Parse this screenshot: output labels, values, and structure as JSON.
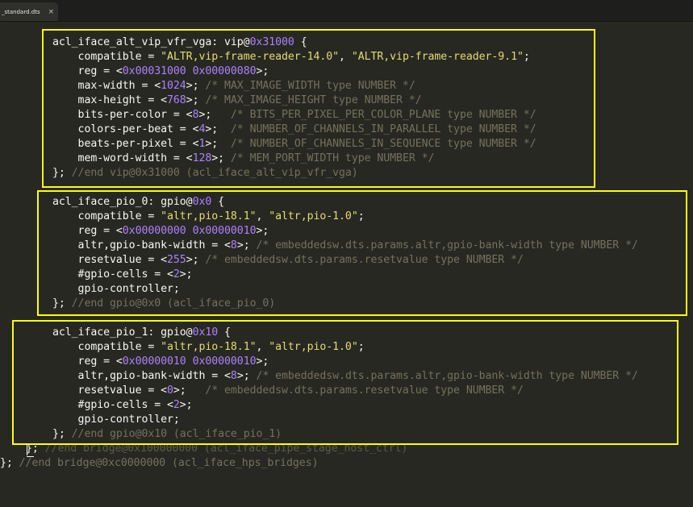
{
  "tab": {
    "title": "_standard.dts",
    "close_glyph": "×"
  },
  "code": [
    [
      [
        "t",
        "acl_iface_alt_vip_vfr_vga: vip@"
      ],
      [
        "n",
        "0x31000"
      ],
      [
        "t",
        " {"
      ]
    ],
    [
      [
        "t",
        "    compatible = "
      ],
      [
        "s",
        "\"ALTR,vip-frame-reader-14.0\""
      ],
      [
        "t",
        ", "
      ],
      [
        "s",
        "\"ALTR,vip-frame-reader-9.1\""
      ],
      [
        "t",
        ";"
      ]
    ],
    [
      [
        "t",
        "    reg = <"
      ],
      [
        "n",
        "0x00031000 0x00000080"
      ],
      [
        "t",
        ">;"
      ]
    ],
    [
      [
        "t",
        "    max-width = <"
      ],
      [
        "n",
        "1024"
      ],
      [
        "t",
        ">; "
      ],
      [
        "c",
        "/* MAX_IMAGE_WIDTH type NUMBER */"
      ]
    ],
    [
      [
        "t",
        "    max-height = <"
      ],
      [
        "n",
        "768"
      ],
      [
        "t",
        ">; "
      ],
      [
        "c",
        "/* MAX_IMAGE_HEIGHT type NUMBER */"
      ]
    ],
    [
      [
        "t",
        "    bits-per-color = <"
      ],
      [
        "n",
        "8"
      ],
      [
        "t",
        ">;   "
      ],
      [
        "c",
        "/* BITS_PER_PIXEL_PER_COLOR_PLANE type NUMBER */"
      ]
    ],
    [
      [
        "t",
        "    colors-per-beat = <"
      ],
      [
        "n",
        "4"
      ],
      [
        "t",
        ">;  "
      ],
      [
        "c",
        "/* NUMBER_OF_CHANNELS_IN_PARALLEL type NUMBER */"
      ]
    ],
    [
      [
        "t",
        "    beats-per-pixel = <"
      ],
      [
        "n",
        "1"
      ],
      [
        "t",
        ">;  "
      ],
      [
        "c",
        "/* NUMBER_OF_CHANNELS_IN_SEQUENCE type NUMBER */"
      ]
    ],
    [
      [
        "t",
        "    mem-word-width = <"
      ],
      [
        "n",
        "128"
      ],
      [
        "t",
        ">; "
      ],
      [
        "c",
        "/* MEM_PORT_WIDTH type NUMBER */"
      ]
    ],
    [
      [
        "t",
        "}; "
      ],
      [
        "c",
        "//end vip@0x31000 (acl_iface_alt_vip_vfr_vga)"
      ]
    ],
    [],
    [
      [
        "t",
        "acl_iface_pio_0: gpio@"
      ],
      [
        "n",
        "0x0"
      ],
      [
        "t",
        " {"
      ]
    ],
    [
      [
        "t",
        "    compatible = "
      ],
      [
        "s",
        "\"altr,pio-18.1\""
      ],
      [
        "t",
        ", "
      ],
      [
        "s",
        "\"altr,pio-1.0\""
      ],
      [
        "t",
        ";"
      ]
    ],
    [
      [
        "t",
        "    reg = <"
      ],
      [
        "n",
        "0x00000000 0x00000010"
      ],
      [
        "t",
        ">;"
      ]
    ],
    [
      [
        "t",
        "    altr,gpio-bank-width = <"
      ],
      [
        "n",
        "8"
      ],
      [
        "t",
        ">; "
      ],
      [
        "c",
        "/* embeddedsw.dts.params.altr,gpio-bank-width type NUMBER */"
      ]
    ],
    [
      [
        "t",
        "    resetvalue = <"
      ],
      [
        "n",
        "255"
      ],
      [
        "t",
        ">; "
      ],
      [
        "c",
        "/* embeddedsw.dts.params.resetvalue type NUMBER */"
      ]
    ],
    [
      [
        "t",
        "    #gpio-cells = <"
      ],
      [
        "n",
        "2"
      ],
      [
        "t",
        ">;"
      ]
    ],
    [
      [
        "t",
        "    gpio-controller;"
      ]
    ],
    [
      [
        "t",
        "}; "
      ],
      [
        "c",
        "//end gpio@0x0 (acl_iface_pio_0)"
      ]
    ],
    [],
    [
      [
        "t",
        "acl_iface_pio_1: gpio@"
      ],
      [
        "n",
        "0x10"
      ],
      [
        "t",
        " {"
      ]
    ],
    [
      [
        "t",
        "    compatible = "
      ],
      [
        "s",
        "\"altr,pio-18.1\""
      ],
      [
        "t",
        ", "
      ],
      [
        "s",
        "\"altr,pio-1.0\""
      ],
      [
        "t",
        ";"
      ]
    ],
    [
      [
        "t",
        "    reg = <"
      ],
      [
        "n",
        "0x00000010 0x00000010"
      ],
      [
        "t",
        ">;"
      ]
    ],
    [
      [
        "t",
        "    altr,gpio-bank-width = <"
      ],
      [
        "n",
        "8"
      ],
      [
        "t",
        ">; "
      ],
      [
        "c",
        "/* embeddedsw.dts.params.altr,gpio-bank-width type NUMBER */"
      ]
    ],
    [
      [
        "t",
        "    resetvalue = <"
      ],
      [
        "n",
        "0"
      ],
      [
        "t",
        ">;   "
      ],
      [
        "c",
        "/* embeddedsw.dts.params.resetvalue type NUMBER */"
      ]
    ],
    [
      [
        "t",
        "    #gpio-cells = <"
      ],
      [
        "n",
        "2"
      ],
      [
        "t",
        ">;"
      ]
    ],
    [
      [
        "t",
        "    gpio-controller;"
      ]
    ],
    [
      [
        "t",
        "}; "
      ],
      [
        "c",
        "//end gpio@0x10 (acl_iface_pio_1)"
      ]
    ],
    [
      [
        "t",
        "};"
      ],
      [
        "f",
        " //end bridge@0x100000000 (acl_iface_pipe_stage_host_ctrl)"
      ]
    ],
    [
      [
        "t",
        "}; "
      ],
      [
        "c",
        "//end bridge@0xc0000000 (acl_iface_hps_bridges)"
      ]
    ]
  ],
  "colors": {
    "background": "#272822",
    "text": "#f8f8f2",
    "string": "#e6db74",
    "number": "#ae81ff",
    "comment": "#75715e",
    "highlight_box": "#fcff06"
  }
}
